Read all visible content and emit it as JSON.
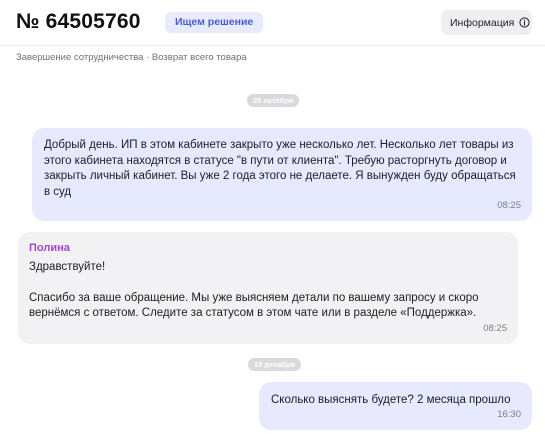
{
  "header": {
    "ticket_number": "№ 64505760",
    "status_badge": "Ищем решение",
    "info_button_label": "Информация",
    "info_icon": "info-circle-icon"
  },
  "breadcrumb": "Завершение сотрудничества · Возврат всего товара",
  "chat": {
    "dates": [
      "29 октября",
      "15 декабря"
    ],
    "messages": [
      {
        "direction": "outgoing",
        "text": "Добрый день. ИП в этом кабинете закрыто уже несколько лет. Несколько лет товары из этого кабинета находятся в статусе \"в пути от клиента\". Требую расторгнуть договор и закрыть личный кабинет. Вы уже 2 года этого не делаете. Я вынужден буду обращаться в суд",
        "time": "08:25"
      },
      {
        "direction": "incoming",
        "sender": "Полина",
        "text": "Здравствуйте!\n\nСпасибо за ваше обращение. Мы уже выясняем детали по вашему запросу и скоро вернёмся с ответом. Следите за статусом в этом чате или в разделе «Поддержка».",
        "time": "08:25"
      },
      {
        "direction": "outgoing",
        "text": "Сколько выяснять будете? 2 месяца прошло",
        "time": "16:30"
      }
    ]
  },
  "colors": {
    "outgoing_bubble": "#e7eaff",
    "incoming_bubble": "#f2f2f4",
    "sender_name": "#a246d6",
    "badge_text": "#4a5bd8"
  }
}
